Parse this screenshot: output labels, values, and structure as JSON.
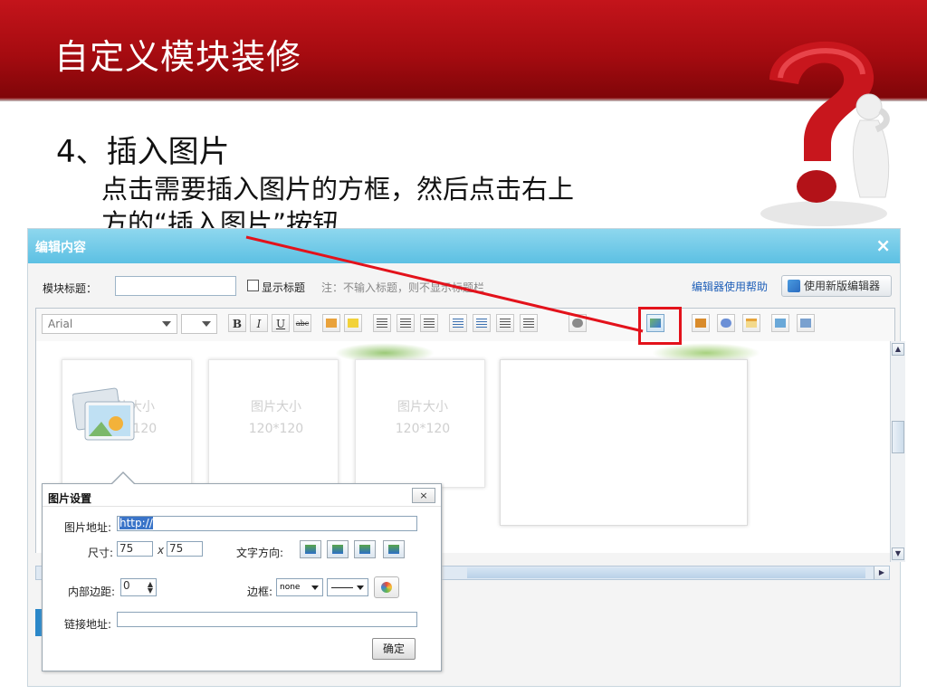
{
  "slide": {
    "title": "自定义模块装修",
    "step_title": "4、插入图片",
    "step_desc_line1": "点击需要插入图片的方框，然后点击右上",
    "step_desc_line2_pre": "方的",
    "step_desc_line2_quoted": "“插入图片”",
    "step_desc_line2_post": "按钮"
  },
  "editor": {
    "header_title": "编辑内容",
    "close_glyph": "×",
    "module_title_label": "模块标题：",
    "show_title_label": "显示标题",
    "show_title_note": "注：不输入标题，则不显示标题栏",
    "help_link": "编辑器使用帮助",
    "new_editor_button": "使用新版编辑器",
    "font_family": "Arial",
    "toolbar": {
      "bold": "B",
      "italic": "I",
      "underline": "U",
      "strike": "abc"
    },
    "placeholders": [
      {
        "line1": "图片大小",
        "line2": "120*120"
      },
      {
        "line1": "图片大小",
        "line2": "120*120"
      },
      {
        "line1": "图片大小",
        "line2": "120*120"
      }
    ]
  },
  "image_dialog": {
    "title": "图片设置",
    "close_glyph": "×",
    "url_label": "图片地址:",
    "url_value": "http://",
    "size_label": "尺寸:",
    "width_value": "75",
    "times_glyph": "x",
    "height_value": "75",
    "text_dir_label": "文字方向:",
    "padding_label": "内部边距:",
    "padding_value": "0",
    "border_label": "边框:",
    "border_style": "none",
    "link_label": "链接地址:",
    "link_value": "",
    "ok_button": "确定"
  },
  "colors": {
    "title_band": "#b5101a",
    "editor_header": "#6ec8e8",
    "highlight": "#e3121b",
    "link": "#1f5fb8"
  }
}
